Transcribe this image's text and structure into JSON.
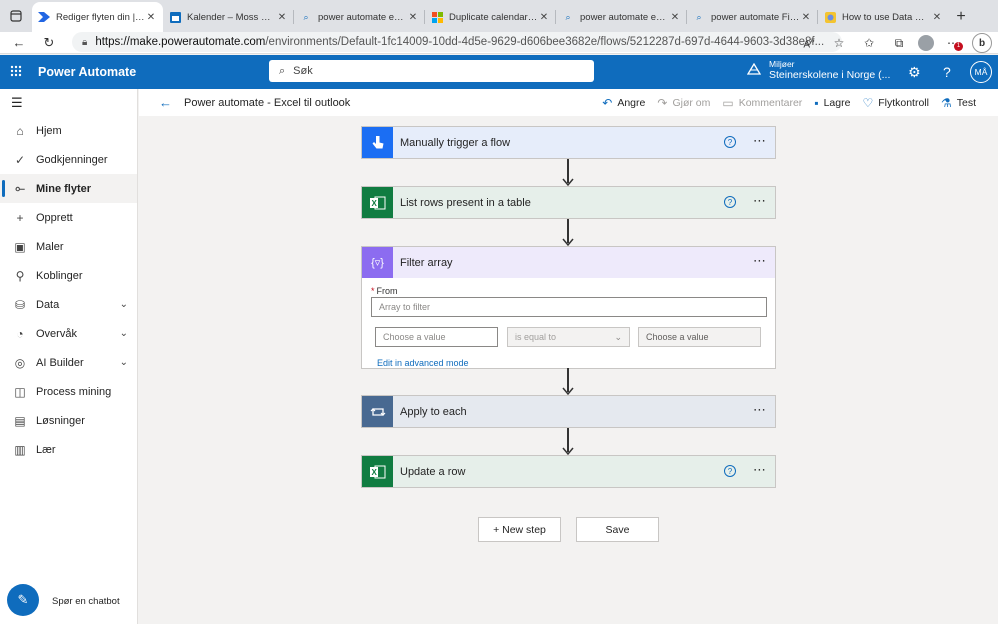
{
  "browser": {
    "tabs": [
      {
        "label": "Rediger flyten din | Po",
        "active": true,
        "favicon": "power-automate-icon"
      },
      {
        "label": "Kalender – Moss Årsp",
        "active": false,
        "favicon": "calendar-icon"
      },
      {
        "label": "power automate exce",
        "active": false,
        "favicon": "search-icon"
      },
      {
        "label": "Duplicate calendar ev",
        "active": false,
        "favicon": "microsoft-icon"
      },
      {
        "label": "power automate exce",
        "active": false,
        "favicon": "search-icon"
      },
      {
        "label": "power automate Filer",
        "active": false,
        "favicon": "search-icon"
      },
      {
        "label": "How to use Data Ope",
        "active": false,
        "favicon": "site-icon"
      }
    ],
    "url_host": "https://make.powerautomate.com",
    "url_path": "/environments/Default-1fc14009-10dd-4d5e-9629-d606bee3682e/flows/5212287d-697d-4644-9603-3d38e8f...",
    "notification_badge": "1"
  },
  "header": {
    "app_name": "Power Automate",
    "search_placeholder": "Søk",
    "env_label": "Miljøer",
    "env_name": "Steinerskolene i Norge (...",
    "avatar_initials": "MÅ",
    "brand_color": "#0f6cbd"
  },
  "sidebar": {
    "items": [
      {
        "label": "Hjem",
        "icon": "home-icon"
      },
      {
        "label": "Godkjenninger",
        "icon": "approvals-icon"
      },
      {
        "label": "Mine flyter",
        "icon": "flows-icon",
        "active": true
      },
      {
        "label": "Opprett",
        "icon": "plus-icon"
      },
      {
        "label": "Maler",
        "icon": "templates-icon"
      },
      {
        "label": "Koblinger",
        "icon": "connectors-icon"
      },
      {
        "label": "Data",
        "icon": "data-icon",
        "expandable": true
      },
      {
        "label": "Overvåk",
        "icon": "monitor-icon",
        "expandable": true
      },
      {
        "label": "AI Builder",
        "icon": "ai-builder-icon",
        "expandable": true
      },
      {
        "label": "Process mining",
        "icon": "process-mining-icon"
      },
      {
        "label": "Løsninger",
        "icon": "solutions-icon"
      },
      {
        "label": "Lær",
        "icon": "learn-icon"
      }
    ],
    "chatbot_label": "Spør en chatbot"
  },
  "commandbar": {
    "flow_title": "Power automate - Excel til outlook",
    "undo": "Angre",
    "redo": "Gjør om",
    "comments": "Kommentarer",
    "save": "Lagre",
    "flow_checker": "Flytkontroll",
    "test": "Test"
  },
  "flow": {
    "steps": [
      {
        "title": "Manually trigger a flow",
        "icon": "manual-trigger-icon",
        "color": "#1b6ef3",
        "bg": "#e6edfa"
      },
      {
        "title": "List rows present in a table",
        "icon": "excel-icon",
        "color": "#107c41",
        "bg": "#e6efea"
      },
      {
        "title": "Filter array",
        "icon": "filter-array-icon",
        "color": "#8c6cf0",
        "bg": "#eeeafb"
      },
      {
        "title": "Apply to each",
        "icon": "loop-icon",
        "color": "#486991",
        "bg": "#e5e9ef"
      },
      {
        "title": "Update a row",
        "icon": "excel-icon",
        "color": "#107c41",
        "bg": "#e6efea"
      }
    ],
    "filter": {
      "from_label": "From",
      "from_placeholder": "Array to filter",
      "left_placeholder": "Choose a value",
      "operator": "is equal to",
      "right_placeholder": "Choose a value",
      "advanced_link": "Edit in advanced mode"
    },
    "new_step": "+ New step",
    "save": "Save"
  }
}
